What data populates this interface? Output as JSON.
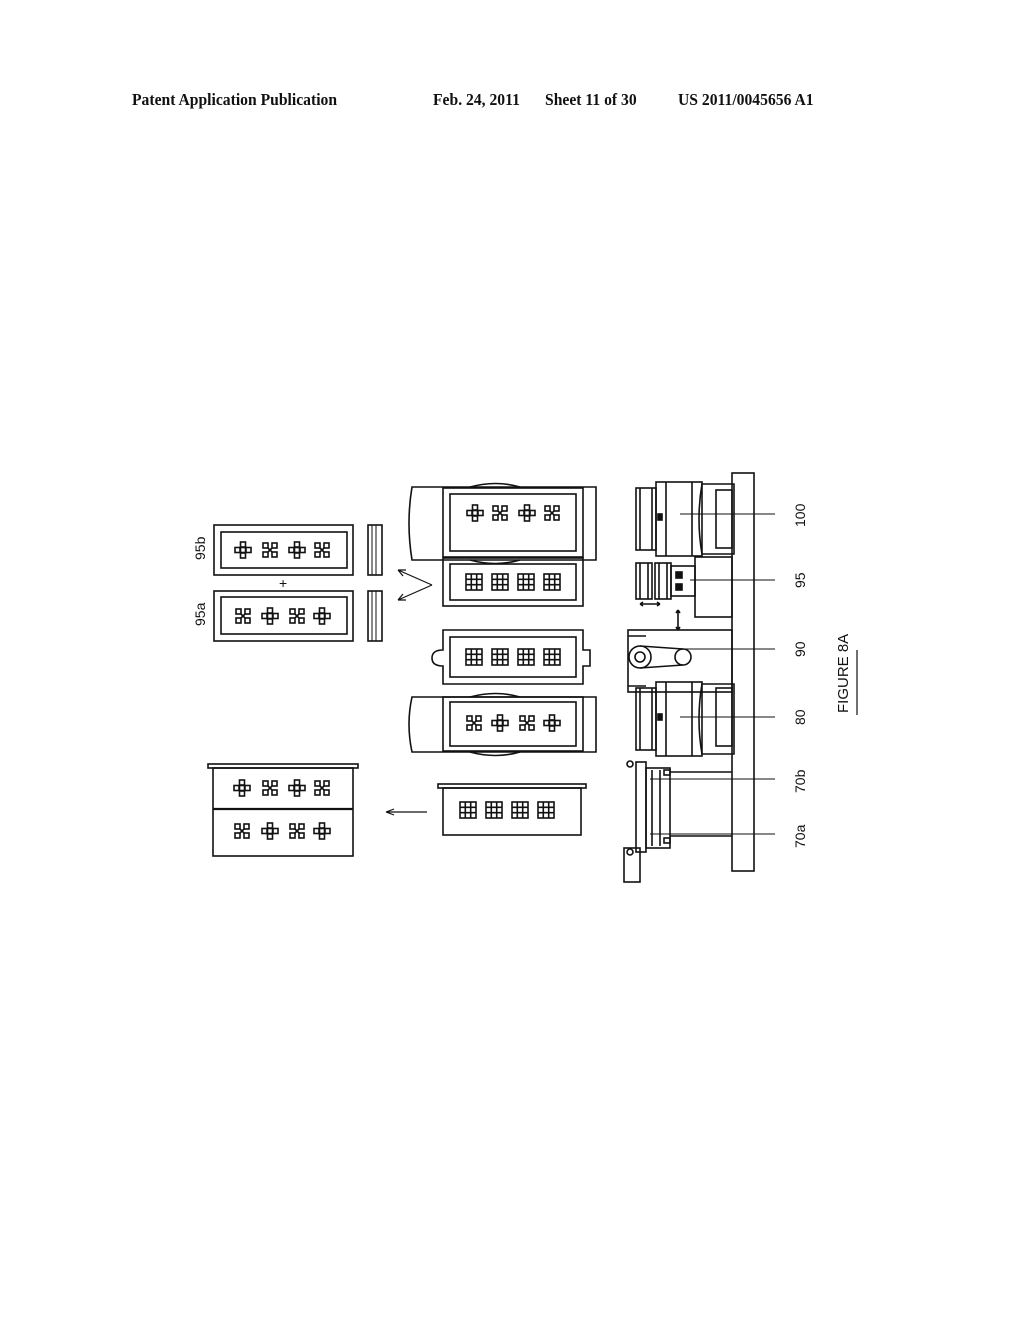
{
  "header": {
    "publication": "Patent Application Publication",
    "date": "Feb. 24, 2011",
    "sheet": "Sheet 11 of 30",
    "number": "US 2011/0045656 A1"
  },
  "figure": {
    "title": "FIGURE 8A",
    "machine_labels": [
      "70a",
      "70b",
      "80",
      "90",
      "95",
      "100"
    ],
    "part_labels": [
      "95a",
      "95b"
    ],
    "plus_sign": "+"
  }
}
